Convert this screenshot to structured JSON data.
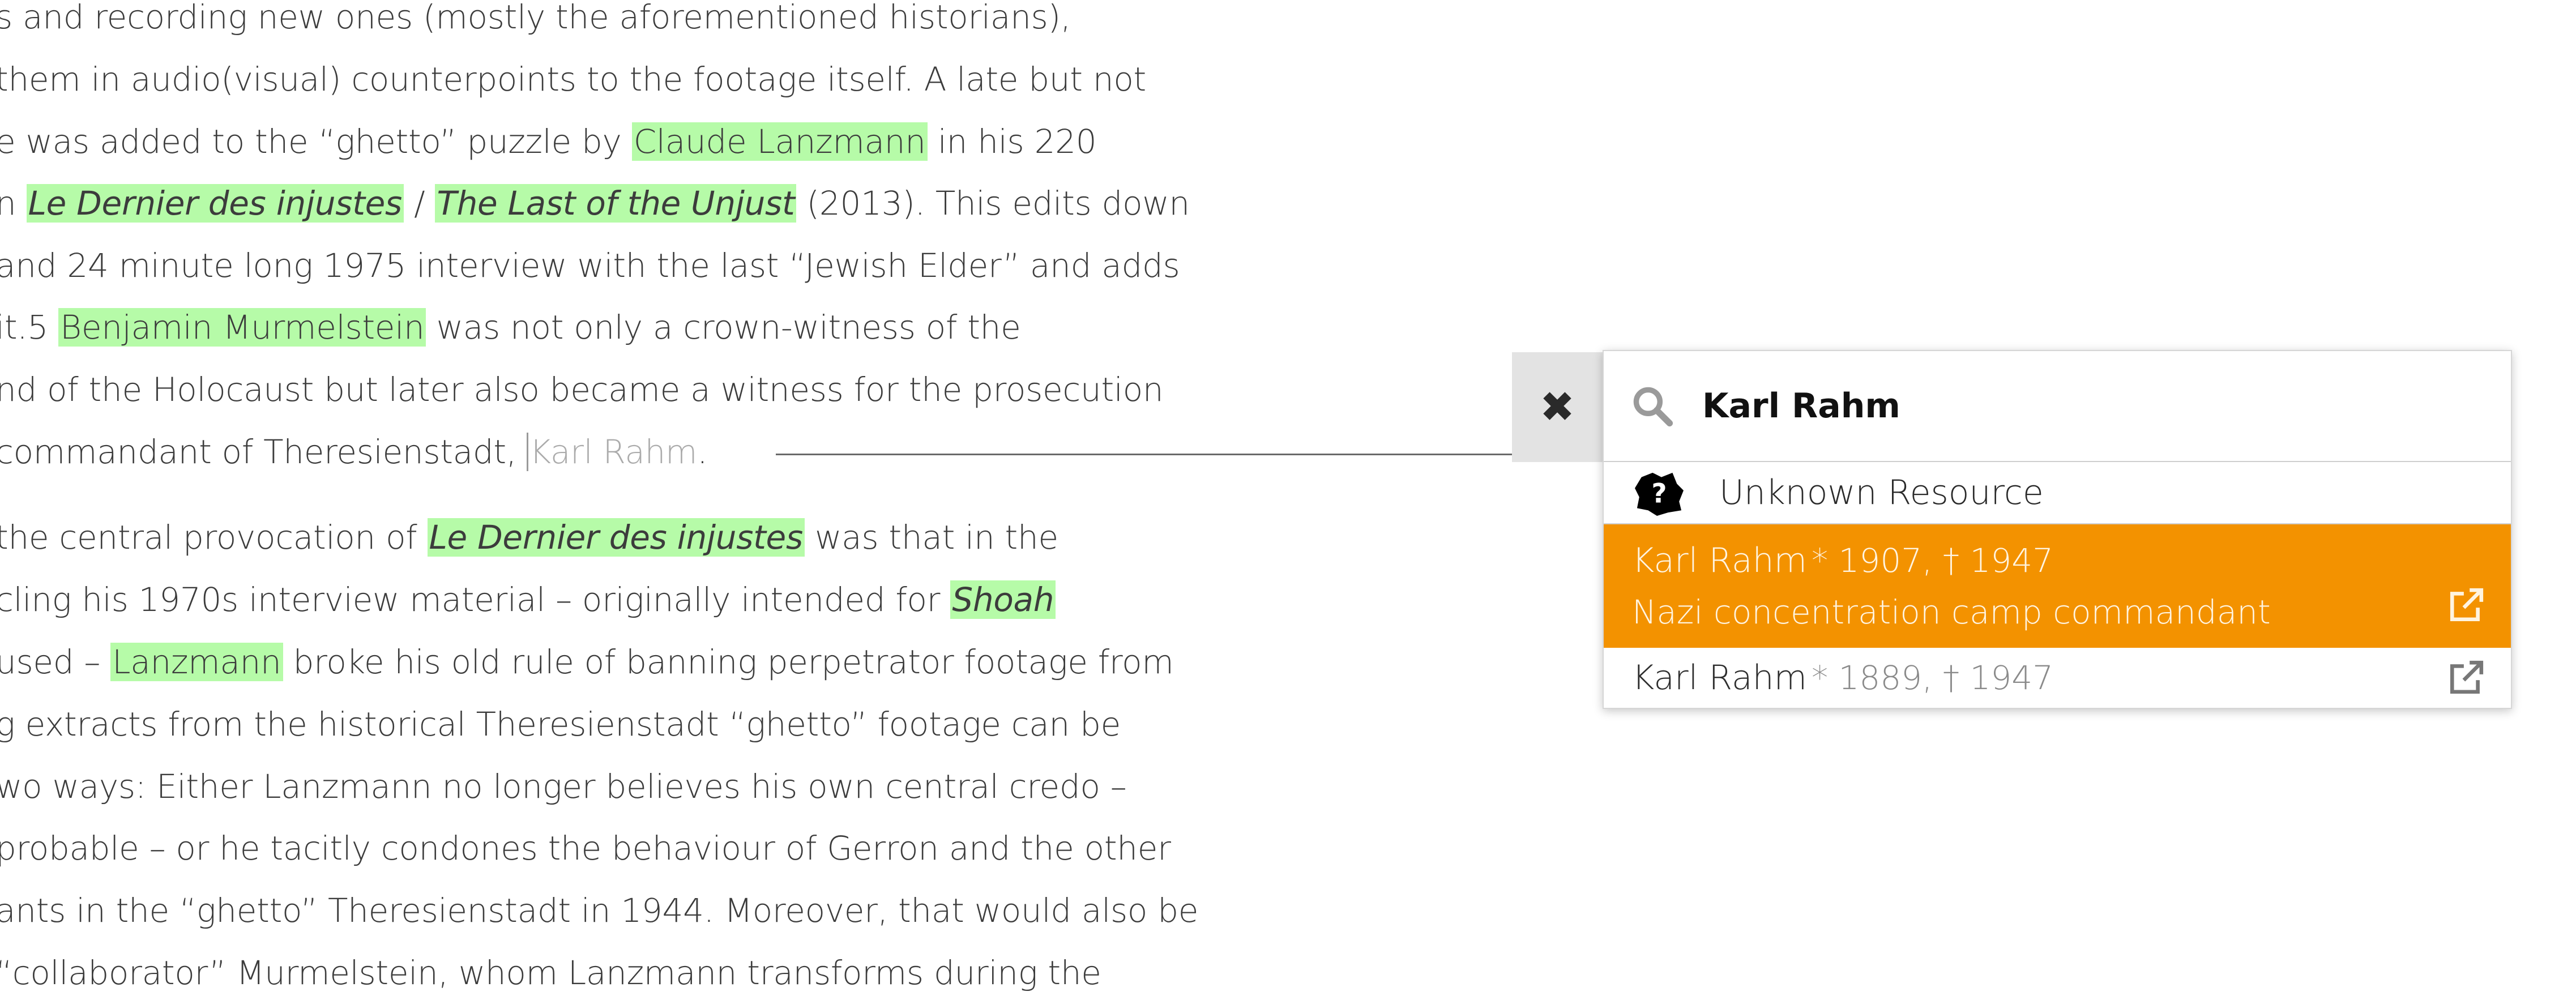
{
  "document": {
    "lines": [
      [
        {
          "t": "s and recording new ones (mostly the aforementioned historians),"
        }
      ],
      [
        {
          "t": "them in audio(visual) counterpoints to the footage itself. A late but not"
        }
      ],
      [
        {
          "t": "e was added to the “ghetto” puzzle by "
        },
        {
          "t": "Claude Lanzmann",
          "hl": true
        },
        {
          "t": " in his 220"
        }
      ],
      [
        {
          "t": "n "
        },
        {
          "t": "Le Dernier des injustes",
          "hl": true,
          "it": true
        },
        {
          "t": " / "
        },
        {
          "t": "The Last of the Unjust",
          "hl": true,
          "it": true
        },
        {
          "t": " (2013). This edits down"
        }
      ],
      [
        {
          "t": " and 24 minute long 1975 interview with the last “Jewish Elder” and adds"
        }
      ],
      [
        {
          "t": "it.5 "
        },
        {
          "t": "Benjamin Murmelstein",
          "hl": true
        },
        {
          "t": " was not only a crown-witness of the"
        }
      ],
      [
        {
          "t": "nd of the Holocaust but later also became a witness for the prosecution"
        }
      ],
      [
        {
          "t": " commandant of Theresienstadt, "
        },
        {
          "t": "Karl Rahm",
          "pending": true
        },
        {
          "t": "."
        }
      ],
      [
        {
          "t": "the central provocation of "
        },
        {
          "t": "Le Dernier des injustes",
          "hl": true,
          "it": true
        },
        {
          "t": " was that in the"
        }
      ],
      [
        {
          "t": "cling his 1970s interview material – originally intended for "
        },
        {
          "t": "Shoah",
          "hl": true,
          "it": true
        }
      ],
      [
        {
          "t": "used – "
        },
        {
          "t": "Lanzmann",
          "hl": true
        },
        {
          "t": " broke his old rule of banning perpetrator footage from"
        }
      ],
      [
        {
          "t": "g extracts from the historical Theresienstadt “ghetto” footage can be"
        }
      ],
      [
        {
          "t": "wo ways: Either Lanzmann no longer believes his own central credo –"
        }
      ],
      [
        {
          "t": "probable – or he tacitly condones the behaviour of Gerron and the other"
        }
      ],
      [
        {
          "t": "ants in the “ghetto” Theresienstadt in 1944. Moreover, that would also be"
        }
      ],
      [
        {
          "t": "“collaborator” Murmelstein, whom Lanzmann transforms during the"
        }
      ]
    ]
  },
  "popup": {
    "close_label": "✖",
    "search": {
      "value": "Karl Rahm",
      "icon": "search-icon"
    },
    "unknown": {
      "label": "Unknown Resource",
      "icon": "unknown-resource-icon"
    },
    "results": [
      {
        "name": "Karl Rahm",
        "dates": "* 1907, † 1947",
        "description": "Nazi concentration camp commandant",
        "selected": true
      },
      {
        "name": "Karl Rahm",
        "dates": "* 1889, † 1947",
        "selected": false
      }
    ]
  },
  "colors": {
    "highlight": "#b6fba8",
    "selected_row": "#f39200",
    "pending_text": "#ababab"
  }
}
